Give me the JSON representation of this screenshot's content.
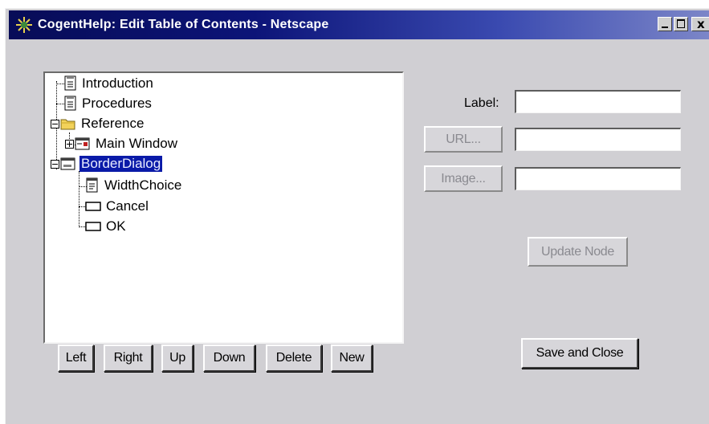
{
  "window": {
    "title": "CogentHelp: Edit Table of Contents - Netscape",
    "close_glyph": "x"
  },
  "tree": {
    "nodes": [
      {
        "label": "Introduction",
        "icon": "document-icon"
      },
      {
        "label": "Procedures",
        "icon": "document-icon"
      },
      {
        "label": "Reference",
        "icon": "folder-icon",
        "expanded": true
      },
      {
        "label": "Main Window",
        "icon": "window-icon",
        "expanded": false
      },
      {
        "label": "BorderDialog",
        "icon": "dialog-icon",
        "expanded": true,
        "selected": true
      },
      {
        "label": "WidthChoice",
        "icon": "choice-icon"
      },
      {
        "label": "Cancel",
        "icon": "button-icon"
      },
      {
        "label": "OK",
        "icon": "button-icon"
      }
    ]
  },
  "tree_buttons": {
    "left": "Left",
    "right": "Right",
    "up": "Up",
    "down": "Down",
    "delete": "Delete",
    "new": "New"
  },
  "form": {
    "label_text": "Label:",
    "label_value": "",
    "url_button": "URL...",
    "url_value": "",
    "image_button": "Image...",
    "image_value": "",
    "update_button": "Update Node",
    "save_button": "Save and Close"
  },
  "colors": {
    "selection": "#0a1aa8",
    "title_bar": "#0c1478",
    "window_bg": "#d0cfd3"
  }
}
